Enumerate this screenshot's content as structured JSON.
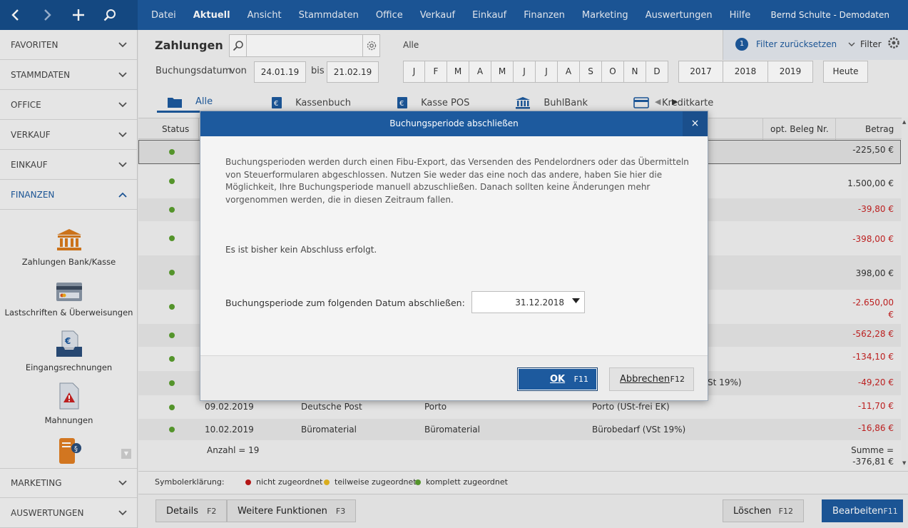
{
  "topbar": {
    "nav": {
      "back": "‹",
      "forward": "›",
      "add": "+"
    },
    "menu": [
      "Datei",
      "Aktuell",
      "Ansicht",
      "Stammdaten",
      "Office",
      "Verkauf",
      "Einkauf",
      "Finanzen",
      "Marketing",
      "Auswertungen",
      "Hilfe"
    ],
    "active_menu": "Aktuell",
    "user": "Bernd Schulte - Demodaten"
  },
  "sidebar": {
    "sections_top": [
      "FAVORITEN",
      "STAMMDATEN",
      "OFFICE",
      "VERKAUF",
      "EINKAUF",
      "FINANZEN"
    ],
    "active_section": "FINANZEN",
    "tiles": [
      "Zahlungen Bank/Kasse",
      "Lastschriften & Überweisungen",
      "Eingangsrechnungen",
      "Mahnungen"
    ],
    "sections_bottom": [
      "MARKETING",
      "AUSWERTUNGEN"
    ]
  },
  "header": {
    "title": "Zahlungen",
    "search_placeholder": "",
    "filter_scope": "Alle",
    "filter_count": "1",
    "filter_reset": "Filter zurücksetzen",
    "filter_label": "Filter"
  },
  "daterange": {
    "label": "Buchungsdatum",
    "von_label": "von",
    "from": "24.01.19",
    "bis_label": "bis",
    "to": "21.02.19",
    "months": [
      "J",
      "F",
      "M",
      "A",
      "M",
      "J",
      "J",
      "A",
      "S",
      "O",
      "N",
      "D"
    ],
    "years": [
      "2017",
      "2018",
      "2019"
    ],
    "today": "Heute"
  },
  "tabs": [
    "Alle",
    "Kassenbuch",
    "Kasse POS",
    "BuhlBank",
    "Kreditkarte"
  ],
  "table": {
    "headers": {
      "status": "Status",
      "beleg": "opt. Beleg Nr.",
      "betrag": "Betrag"
    },
    "amounts": [
      "-225,50 €",
      "1.500,00 €",
      "-39,80 €",
      "-398,00 €",
      "398,00 €",
      "-2.650,00 €",
      "-562,28 €",
      "-134,10 €",
      "-49,20 €",
      "-11,70 €",
      "-16,86 €"
    ],
    "partial_text_row9": "/St 19%)",
    "row10": {
      "date": "09.02.2019",
      "partner": "Deutsche Post",
      "text": "Porto",
      "account": "Porto (USt-frei EK)"
    },
    "row11": {
      "date": "10.02.2019",
      "partner": "Büromaterial",
      "text": "Büromaterial",
      "account": "Bürobedarf (VSt 19%)"
    },
    "count": "Anzahl = 19",
    "sum_label": "Summe =",
    "sum_value": "-376,81 €"
  },
  "legend": {
    "title": "Symbolerklärung:",
    "red": "nicht zugeordnet",
    "yellow": "teilweise zugeordnet",
    "green": "komplett zugeordnet"
  },
  "actions": {
    "details": "Details",
    "details_key": "F2",
    "more": "Weitere Funktionen",
    "more_key": "F3",
    "delete": "Löschen",
    "delete_key": "F12",
    "edit": "Bearbeiten",
    "edit_key": "F11"
  },
  "modal": {
    "title": "Buchungsperiode abschließen",
    "close": "×",
    "description": "Buchungsperioden werden durch einen Fibu-Export, das Versenden des Pendelordners oder das Übermitteln von Steuerformularen abgeschlossen. Nutzen Sie weder das eine noch das andere, haben Sie hier die Möglichkeit, Ihre Buchungsperiode manuell abzuschließen. Danach sollten keine Änderungen mehr vorgenommen werden, die in diesen Zeitraum fallen.",
    "status": "Es ist bisher kein Abschluss erfolgt.",
    "field_label": "Buchungsperiode zum folgenden Datum abschließen:",
    "field_value": "31.12.2018",
    "ok": "OK",
    "ok_key": "F11",
    "cancel": "Abbrechen",
    "cancel_key": "F12"
  },
  "colors": {
    "brand": "#1d5a9e",
    "negative": "#c82222",
    "green": "#5a9e2e",
    "yellow": "#e8b820",
    "red": "#c01818"
  }
}
